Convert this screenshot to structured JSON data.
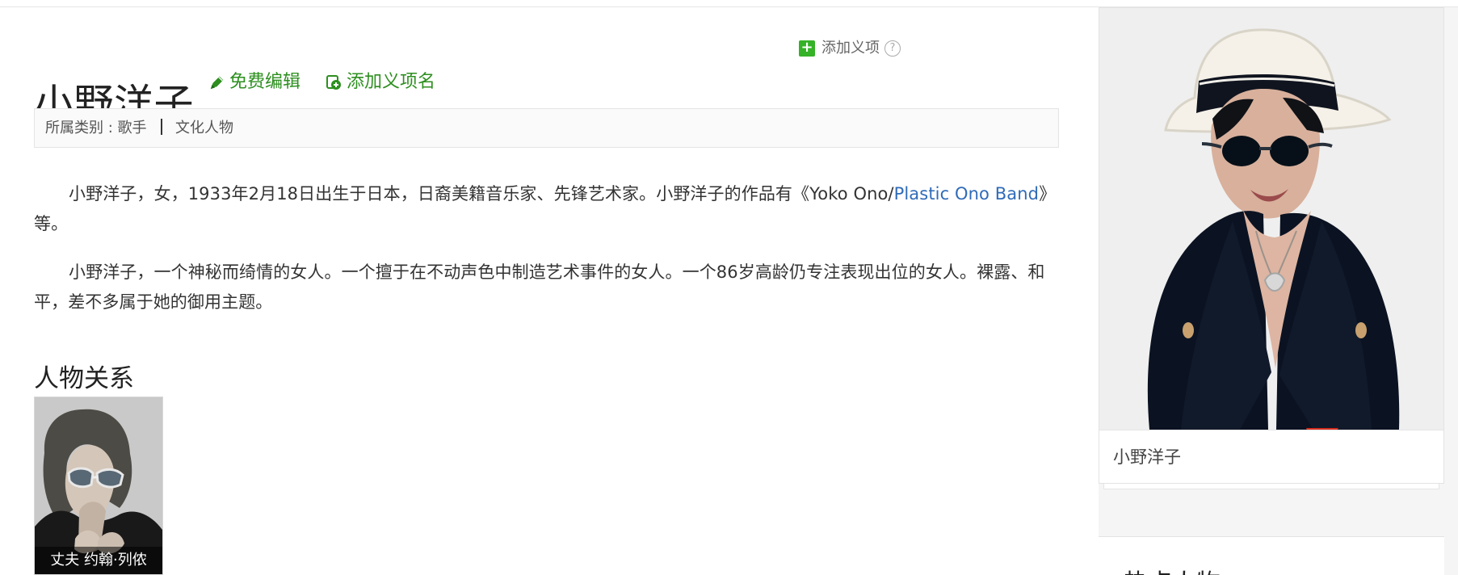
{
  "article": {
    "title": "小野洋子",
    "edit_label": "免费编辑",
    "add_name_label": "添加义项名",
    "add_meaning_label": "添加义项",
    "help_symbol": "?",
    "category": {
      "prefix": "所属类别 : 歌手",
      "value": "文化人物"
    },
    "paragraphs": [
      {
        "text_before_link": "小野洋子，女，1933年2月18日出生于日本，日裔美籍音乐家、先锋艺术家。小野洋子的作品有《Yoko Ono/",
        "link_text": "Plastic Ono Band",
        "text_after_link": "》等。"
      },
      {
        "text": "小野洋子，一个神秘而绮情的女人。一个擅于在不动声色中制造艺术事件的女人。一个86岁高龄仍专注表现出位的女人。裸露、和平，差不多属于她的御用主题。"
      }
    ],
    "section_title": "人物关系",
    "relation": {
      "caption": "丈夫 约翰·列侬"
    }
  },
  "sidebar": {
    "portrait_caption": "小野洋子",
    "hot_title": "热点人物"
  },
  "colors": {
    "accent_green": "#2d8f1f",
    "link_blue": "#2f6bb8",
    "plus_green": "#35b227"
  },
  "icons": {
    "edit": "pencil-icon",
    "add_name": "add-name-icon",
    "add_meaning": "plus-icon",
    "help": "help-icon"
  }
}
